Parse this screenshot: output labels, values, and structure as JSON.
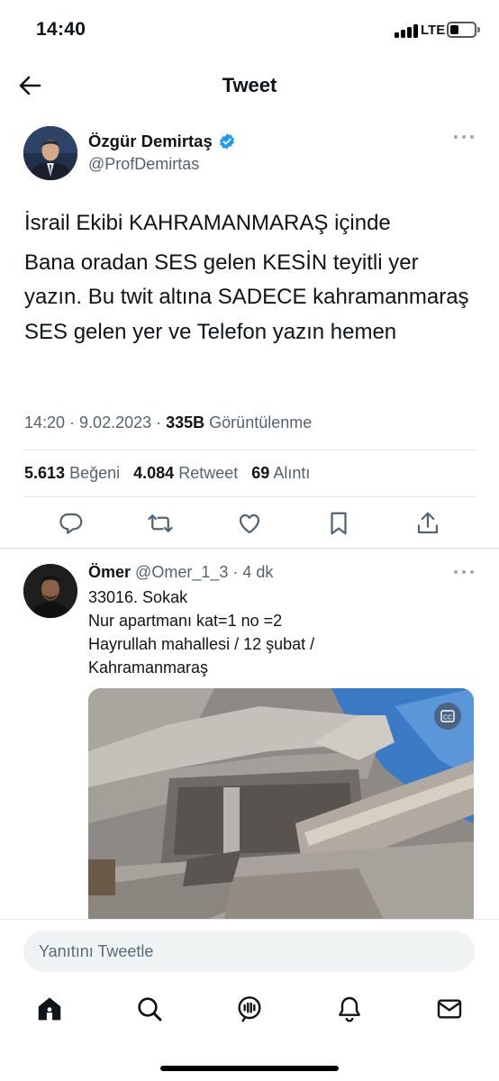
{
  "status_bar": {
    "time": "14:40",
    "network": "LTE"
  },
  "header": {
    "title": "Tweet"
  },
  "tweet": {
    "author_name": "Özgür Demirtaş",
    "author_handle": "@ProfDemirtas",
    "verified": true,
    "text_line1": "İsrail Ekibi KAHRAMANMARAŞ içinde",
    "text_rest": "Bana oradan SES gelen KESİN teyitli yer yazın. Bu twit altına SADECE kahramanmaraş SES gelen yer ve Telefon yazın hemen",
    "time": "14:20",
    "date": "9.02.2023",
    "views_count": "335B",
    "views_label": "Görüntülenme",
    "likes_count": "5.613",
    "likes_label": "Beğeni",
    "retweets_count": "4.084",
    "retweets_label": "Retweet",
    "quotes_count": "69",
    "quotes_label": "Alıntı"
  },
  "actions": [
    "reply-icon",
    "retweet-icon",
    "like-icon",
    "bookmark-icon",
    "share-icon"
  ],
  "reply": {
    "author_name": "Ömer",
    "author_handle": "@Omer_1_3",
    "time_ago": "4 dk",
    "lines": [
      "33016. Sokak",
      "Nur apartmanı kat=1 no =2",
      "Hayrullah mahallesi / 12 şubat /",
      "Kahramanmaraş"
    ]
  },
  "compose": {
    "placeholder": "Yanıtını Tweetle"
  },
  "tabbar": [
    "home-icon",
    "search-icon",
    "spaces-icon",
    "notifications-icon",
    "messages-icon"
  ],
  "colors": {
    "accent": "#1d9bf0",
    "muted": "#536471",
    "text": "#0f1419"
  }
}
